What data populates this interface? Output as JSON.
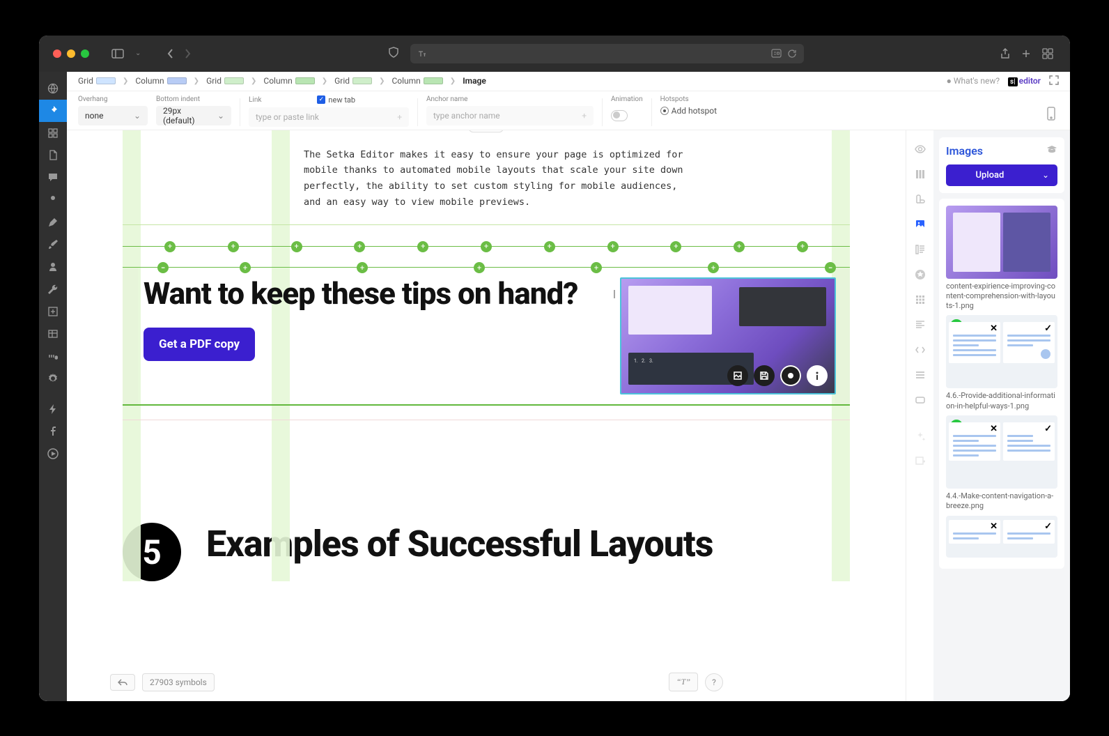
{
  "browser": {
    "traffic": [
      "close",
      "min",
      "max"
    ]
  },
  "breadcrumb": [
    {
      "label": "Grid",
      "color": "#cfe4ff"
    },
    {
      "label": "Column",
      "color": "#b8ccf5"
    },
    {
      "label": "Grid",
      "color": "#cfeeca"
    },
    {
      "label": "Column",
      "color": "#b9e5b3"
    },
    {
      "label": "Grid",
      "color": "#cfeeca"
    },
    {
      "label": "Column",
      "color": "#b9e5b3"
    },
    {
      "label": "Image",
      "color": ""
    }
  ],
  "whats_new": "What's new?",
  "brand_prefix": "s|",
  "brand_name": "editor",
  "options": {
    "overhang": {
      "label": "Overhang",
      "value": "none"
    },
    "bottom_indent": {
      "label": "Bottom indent",
      "value": "29px (default)"
    },
    "link": {
      "label": "Link",
      "placeholder": "type or paste link",
      "newtab_label": "new tab",
      "newtab_checked": true
    },
    "anchor": {
      "label": "Anchor name",
      "placeholder": "type anchor name"
    },
    "animation": {
      "label": "Animation"
    },
    "hotspots": {
      "label": "Hotspots",
      "add": "Add hotspot"
    }
  },
  "content": {
    "paragraph": "The Setka Editor makes it easy to ensure your page is optimized for mobile thanks to automated mobile layouts that scale your site down perfectly, the ability to set custom styling for mobile audiences, and an easy way to view mobile previews.",
    "cta_heading": "Want to keep these tips on hand?",
    "cta_button": "Get a PDF copy",
    "next_heading_num": "5",
    "next_heading": "Examples of Successful Layouts"
  },
  "status": {
    "symbols": "27903 symbols"
  },
  "images_panel": {
    "title": "Images",
    "upload": "Upload",
    "items": [
      {
        "name": "content-expirience-improving-content-comprehension-with-layouts-1.png",
        "type": "purple"
      },
      {
        "name": "4.6.-Provide-additional-information-in-helpful-ways-1.png",
        "type": "wf"
      },
      {
        "name": "4.4.-Make-content-navigation-a-breeze.png",
        "type": "wf"
      },
      {
        "name": "",
        "type": "wf"
      }
    ]
  }
}
